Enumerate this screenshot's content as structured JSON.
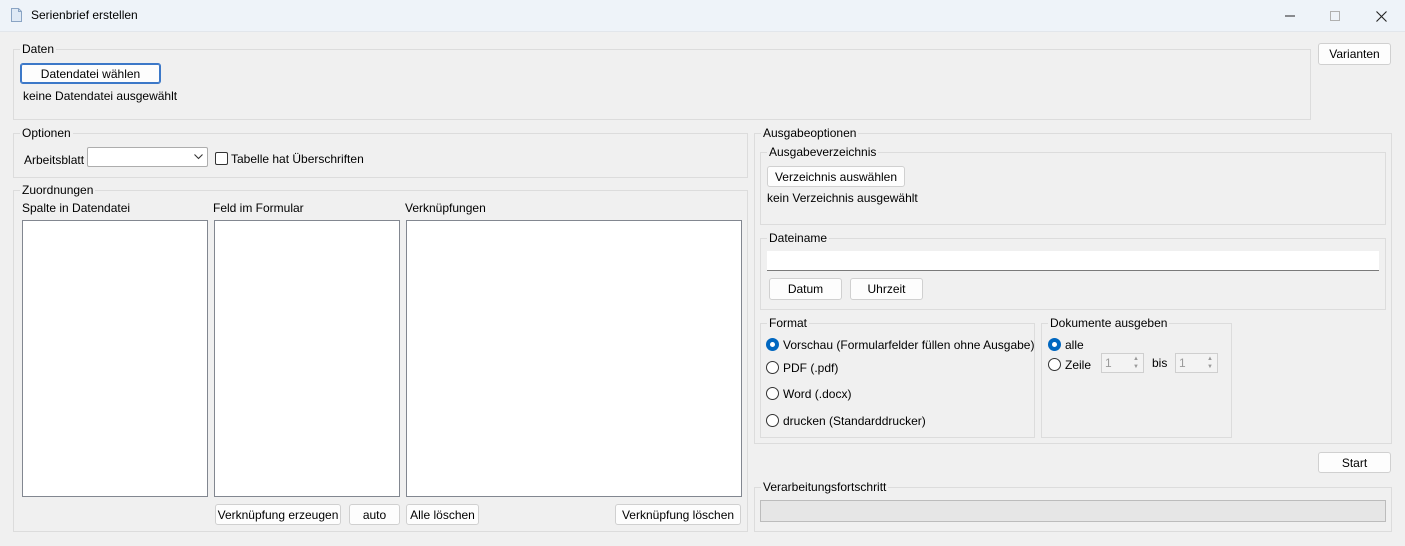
{
  "window": {
    "title": "Serienbrief erstellen",
    "minimize": "—",
    "maximize": "☐",
    "close": "✕"
  },
  "daten": {
    "label": "Daten",
    "choose_button": "Datendatei wählen",
    "status": "keine Datendatei ausgewählt"
  },
  "varianten_button": "Varianten",
  "optionen": {
    "label": "Optionen",
    "worksheet_label": "Arbeitsblatt",
    "worksheet_value": "",
    "header_checkbox_label": "Tabelle hat Überschriften",
    "header_checkbox_checked": false
  },
  "zuordnungen": {
    "label": "Zuordnungen",
    "col_datafile": "Spalte in Datendatei",
    "col_formfield": "Feld im Formular",
    "col_links": "Verknüpfungen",
    "btn_create_link": "Verknüpfung erzeugen",
    "btn_auto": "auto",
    "btn_clear_all": "Alle löschen",
    "btn_delete_link": "Verknüpfung löschen"
  },
  "ausgabeoptionen": {
    "label": "Ausgabeoptionen",
    "verzeichnis": {
      "label": "Ausgabeverzeichnis",
      "button": "Verzeichnis auswählen",
      "status": "kein Verzeichnis ausgewählt"
    },
    "dateiname": {
      "label": "Dateiname",
      "value": "",
      "btn_date": "Datum",
      "btn_time": "Uhrzeit"
    },
    "format": {
      "label": "Format",
      "options": [
        {
          "label": "Vorschau (Formularfelder füllen ohne Ausgabe)",
          "selected": true
        },
        {
          "label": "PDF (.pdf)",
          "selected": false
        },
        {
          "label": "Word (.docx)",
          "selected": false
        },
        {
          "label": "drucken (Standarddrucker)",
          "selected": false
        }
      ]
    },
    "dokumente": {
      "label": "Dokumente ausgeben",
      "opt_all": "alle",
      "opt_row": "Zeile",
      "from_value": "1",
      "to_label": "bis",
      "to_value": "1",
      "selected": "alle"
    }
  },
  "start_button": "Start",
  "progress": {
    "label": "Verarbeitungsfortschritt",
    "value": 0
  },
  "icons": {
    "app": "document-icon",
    "spin_up": "▲",
    "spin_down": "▼",
    "dropdown": "chevron-down-icon"
  }
}
